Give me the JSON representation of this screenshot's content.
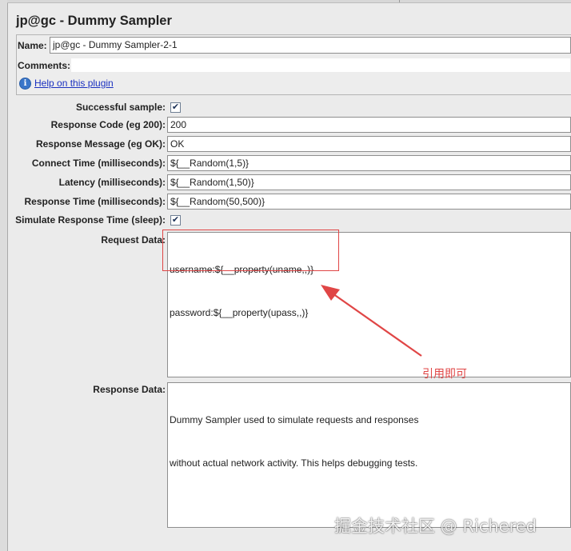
{
  "window": {
    "title": "jp@gc - Dummy Sampler"
  },
  "header": {
    "name_label": "Name:",
    "name_value": "jp@gc - Dummy Sampler-2-1",
    "comments_label": "Comments:",
    "help_link": "Help on this plugin"
  },
  "fields": {
    "successful_sample_label": "Successful sample:",
    "successful_sample_checked": true,
    "response_code_label": "Response Code (eg 200):",
    "response_code_value": "200",
    "response_message_label": "Response Message (eg OK):",
    "response_message_value": "OK",
    "connect_time_label": "Connect Time (milliseconds):",
    "connect_time_value": "${__Random(1,5)}",
    "latency_label": "Latency (milliseconds):",
    "latency_value": "${__Random(1,50)}",
    "response_time_label": "Response Time (milliseconds):",
    "response_time_value": "${__Random(50,500)}",
    "simulate_label": "Simulate Response Time (sleep):",
    "simulate_checked": true,
    "request_data_label": "Request Data:",
    "request_data_lines": [
      "username:${__property(uname,,)}",
      "password:${__property(upass,,)}"
    ],
    "response_data_label": "Response Data:",
    "response_data_lines": [
      "Dummy Sampler used to simulate requests and responses",
      "without actual network activity. This helps debugging tests."
    ]
  },
  "annotation": {
    "text": "引用即可",
    "color": "#e04646"
  },
  "watermark": {
    "text": "掘金技术社区 @ Richered"
  },
  "icons": {
    "check": "✔",
    "info": "i"
  }
}
